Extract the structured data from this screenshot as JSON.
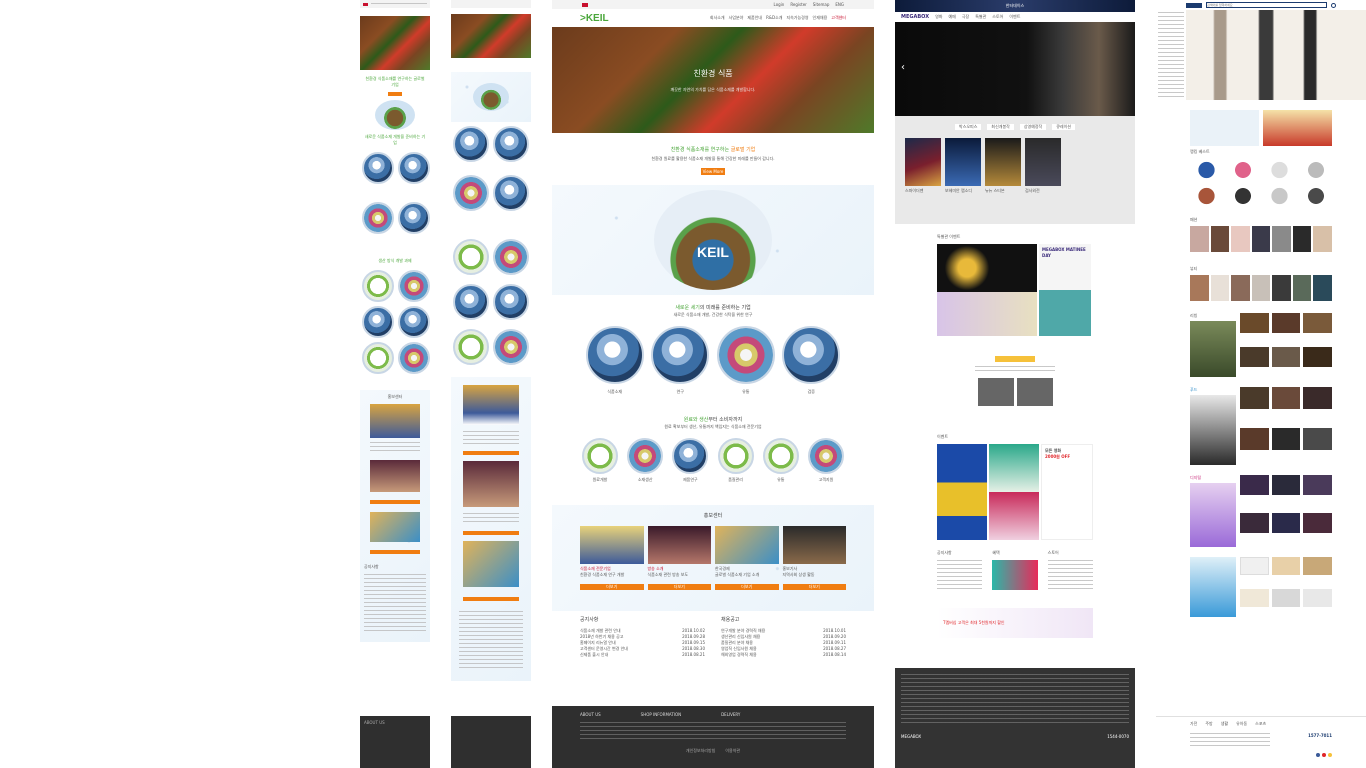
{
  "col1": {
    "title": "친환경 식품소재를 연구하는 글로벌 기업",
    "subtitle": "새로운 식품소재 개발을 준비하는 기업",
    "section_title": "생산 방식 개발 과제",
    "news_title": "홍보센터",
    "notice_title": "공지사항",
    "footer_label": "ABOUT US"
  },
  "col3": {
    "header_menu": [
      "회사소개",
      "사업분야",
      "제품안내",
      "R&D소개",
      "지속가능경영",
      "인재채용",
      "고객센터"
    ],
    "top_links": [
      "Login",
      "Register",
      "Sitemap",
      "ENG"
    ],
    "hero_title": "친환경 식품",
    "hero_desc": "깨끗한 자연의 가치를 담은 식품소재를 개발합니다.",
    "intro_title_green": "친환경 식품소재를 연구하는",
    "intro_title_orange": "글로벌 기업",
    "intro_desc": "친환경 원료를 활용한 식품소재 개발을 통해 건강한 미래를 만들어 갑니다.",
    "more_button": "View More",
    "globe_logo": "KEIL",
    "vision_title_green": "새로운 세기",
    "vision_title_rest": "의 미래를 준비하는 기업",
    "vision_desc": "새로운 식품소재 개발, 건강한 식탁을 위한 연구",
    "vision_items": [
      "식품소재",
      "연구",
      "유통",
      "검증"
    ],
    "biz_title_green": "원료와 생산",
    "biz_title_rest": "부터 소비자까지",
    "biz_desc": "원료 확보부터 생산, 유통까지 책임지는 식품소재 전문기업",
    "biz_items": [
      "원료개발",
      "소재생산",
      "제품연구",
      "품질관리",
      "유통",
      "고객지원"
    ],
    "pr_title": "홍보센터",
    "pr_cards": [
      {
        "caption": "식품소재 전문기업",
        "desc": "친환경 식품소재 연구 개발"
      },
      {
        "caption": "방송 소개",
        "desc": "식품소재 관련 방송 보도"
      },
      {
        "caption": "한국경제",
        "desc": "글로벌 식품소재 기업 소개"
      },
      {
        "caption": "홍보기사",
        "desc": "지역사회 상생 활동"
      }
    ],
    "card_button": "더보기",
    "notice_title": "공지사항",
    "recruit_title": "채용공고",
    "notices": [
      "식품소재 개발 관련 안내",
      "2018년 하반기 채용 공고",
      "홈페이지 리뉴얼 안내",
      "고객센터 운영시간 변경 안내",
      "신제품 출시 안내"
    ],
    "notice_dates": [
      "2018.10.02",
      "2018.09.28",
      "2018.09.15",
      "2018.08.30",
      "2018.08.21"
    ],
    "recruits": [
      "연구개발 분야 경력직 채용",
      "생산관리 신입사원 채용",
      "품질관리 분야 채용",
      "영업직 신입사원 채용",
      "해외영업 경력직 채용"
    ],
    "recruit_dates": [
      "2018.10.01",
      "2018.09.20",
      "2018.09.11",
      "2018.08.27",
      "2018.08.14"
    ],
    "footer_cols": [
      "ABOUT US",
      "SHOP INFORMATION",
      "DELIVERY"
    ],
    "footer_links": [
      "개인정보처리방침",
      "이용약관"
    ]
  },
  "col4": {
    "top_banner": "한터데이스",
    "logo": "MEGABOX",
    "nav": [
      "영화",
      "예매",
      "극장",
      "특별관",
      "스토어",
      "이벤트",
      "혜택"
    ],
    "tabs": [
      "박스오피스",
      "최신개봉작",
      "상영예정작",
      "큐레이션"
    ],
    "movies": [
      "스파이더맨",
      "보헤미안 랩소디",
      "뉴뉴 스티븐",
      "검사외전"
    ],
    "special_title": "특별관 이벤트",
    "matinee_title": "MEGABOX MATINEE DAY",
    "event_title": "이벤트",
    "sale_title": "모든 영화",
    "sale_price": "2000원 OFF",
    "tplus": "T멤버십 고객은 최대 5천원까지 할인",
    "notice_title": "공지사항",
    "benefit_title": "혜택",
    "store_title": "스토어",
    "footer_logo": "MEGABOX",
    "footer_phone": "1544-0070"
  },
  "col5": {
    "search_placeholder": "검색어를 입력하세요",
    "section_labels": [
      "패션",
      "뷰티",
      "리빙",
      "푸드",
      "디지털"
    ],
    "promo": "랭킹 베스트",
    "category_labels": [
      "가전",
      "주방",
      "생활",
      "유아동",
      "스포츠"
    ],
    "bottom_phone": "1577-7011"
  },
  "colors": {
    "green": "#4aa63a",
    "orange": "#f07d11",
    "dark": "#2f2f2f",
    "navy": "#1b3b6f"
  }
}
